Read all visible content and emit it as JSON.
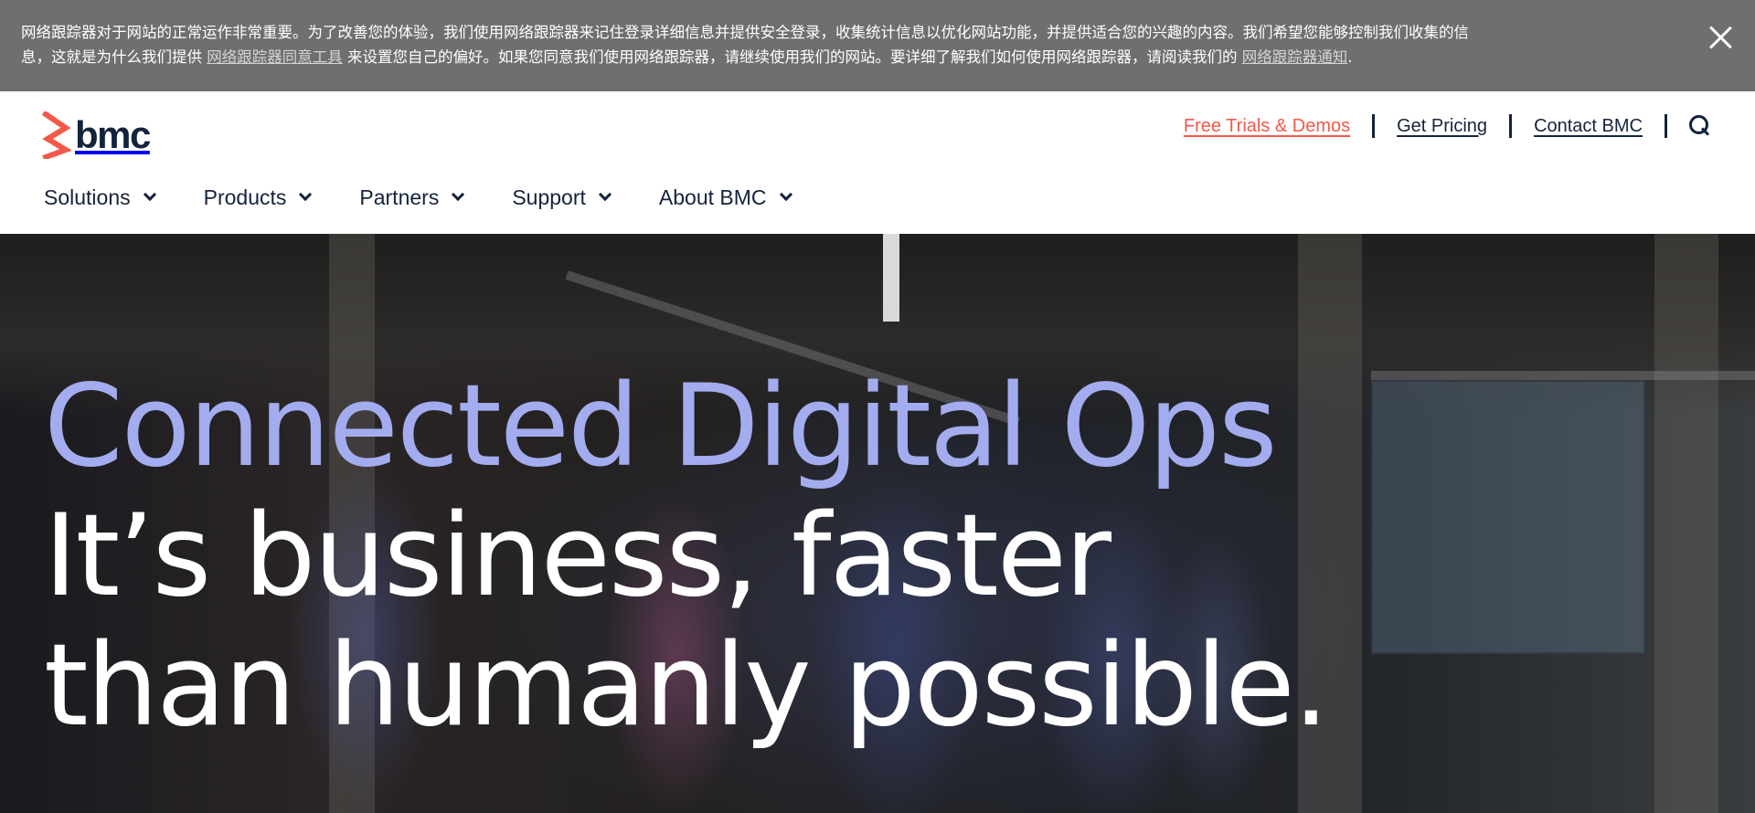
{
  "cookie_banner": {
    "line1": "网络跟踪器对于网站的正常运作非常重要。为了改善您的体验，我们使用网络跟踪器来记住登录详细信息并提供安全登录，收集统计信息以优化网站功能，并提供适合您的兴趣的内容。我们希望您能够控制我们收集的信",
    "line2_before": "息，这就是为什么我们提供 ",
    "consent_link": "网络跟踪器同意工具",
    "line2_middle": " 来设置您自己的偏好。如果您同意我们使用网络跟踪器，请继续使用我们的网站。要详细了解我们如何使用网络跟踪器，请阅读我们的 ",
    "notice_link": "网络跟踪器通知",
    "line2_after": ".",
    "close_icon": "close-icon"
  },
  "header": {
    "logo_text": "bmc",
    "logo_color": "#f2584a",
    "utility": {
      "free_trials": "Free Trials & Demos",
      "get_pricing": "Get Pricing",
      "contact": "Contact BMC",
      "search_icon": "search-icon"
    },
    "nav": [
      {
        "label": "Solutions"
      },
      {
        "label": "Products"
      },
      {
        "label": "Partners"
      },
      {
        "label": "Support"
      },
      {
        "label": "About BMC"
      }
    ]
  },
  "hero": {
    "accent_line": "Connected Digital Ops",
    "line2": "It’s business, faster",
    "line3": "than humanly possible.",
    "accent_color": "#a3acee"
  }
}
